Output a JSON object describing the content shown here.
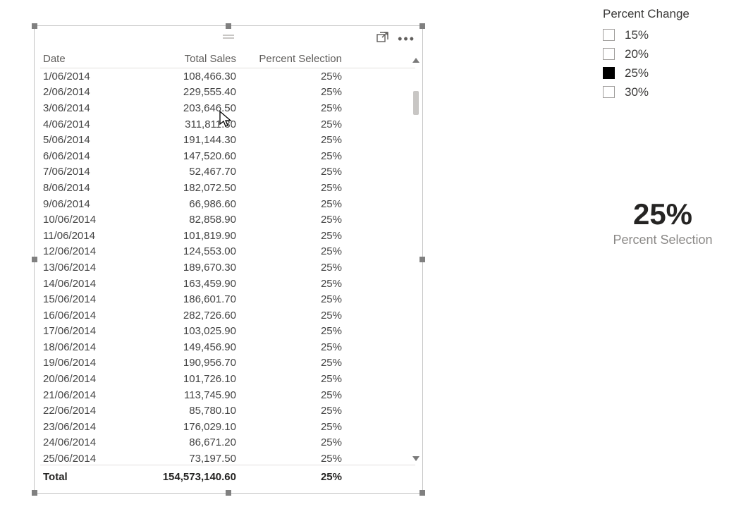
{
  "table": {
    "headers": {
      "date": "Date",
      "sales": "Total Sales",
      "pct": "Percent Selection"
    },
    "rows": [
      {
        "date": "1/06/2014",
        "sales": "108,466.30",
        "pct": "25%"
      },
      {
        "date": "2/06/2014",
        "sales": "229,555.40",
        "pct": "25%"
      },
      {
        "date": "3/06/2014",
        "sales": "203,646.50",
        "pct": "25%"
      },
      {
        "date": "4/06/2014",
        "sales": "311,811.30",
        "pct": "25%"
      },
      {
        "date": "5/06/2014",
        "sales": "191,144.30",
        "pct": "25%"
      },
      {
        "date": "6/06/2014",
        "sales": "147,520.60",
        "pct": "25%"
      },
      {
        "date": "7/06/2014",
        "sales": "52,467.70",
        "pct": "25%"
      },
      {
        "date": "8/06/2014",
        "sales": "182,072.50",
        "pct": "25%"
      },
      {
        "date": "9/06/2014",
        "sales": "66,986.60",
        "pct": "25%"
      },
      {
        "date": "10/06/2014",
        "sales": "82,858.90",
        "pct": "25%"
      },
      {
        "date": "11/06/2014",
        "sales": "101,819.90",
        "pct": "25%"
      },
      {
        "date": "12/06/2014",
        "sales": "124,553.00",
        "pct": "25%"
      },
      {
        "date": "13/06/2014",
        "sales": "189,670.30",
        "pct": "25%"
      },
      {
        "date": "14/06/2014",
        "sales": "163,459.90",
        "pct": "25%"
      },
      {
        "date": "15/06/2014",
        "sales": "186,601.70",
        "pct": "25%"
      },
      {
        "date": "16/06/2014",
        "sales": "282,726.60",
        "pct": "25%"
      },
      {
        "date": "17/06/2014",
        "sales": "103,025.90",
        "pct": "25%"
      },
      {
        "date": "18/06/2014",
        "sales": "149,456.90",
        "pct": "25%"
      },
      {
        "date": "19/06/2014",
        "sales": "190,956.70",
        "pct": "25%"
      },
      {
        "date": "20/06/2014",
        "sales": "101,726.10",
        "pct": "25%"
      },
      {
        "date": "21/06/2014",
        "sales": "113,745.90",
        "pct": "25%"
      },
      {
        "date": "22/06/2014",
        "sales": "85,780.10",
        "pct": "25%"
      },
      {
        "date": "23/06/2014",
        "sales": "176,029.10",
        "pct": "25%"
      },
      {
        "date": "24/06/2014",
        "sales": "86,671.20",
        "pct": "25%"
      },
      {
        "date": "25/06/2014",
        "sales": "73,197.50",
        "pct": "25%"
      }
    ],
    "total": {
      "label": "Total",
      "sales": "154,573,140.60",
      "pct": "25%"
    }
  },
  "slicer": {
    "title": "Percent Change",
    "options": [
      {
        "label": "15%",
        "selected": false
      },
      {
        "label": "20%",
        "selected": false
      },
      {
        "label": "25%",
        "selected": true
      },
      {
        "label": "30%",
        "selected": false
      }
    ]
  },
  "card": {
    "value": "25%",
    "label": "Percent Selection"
  }
}
